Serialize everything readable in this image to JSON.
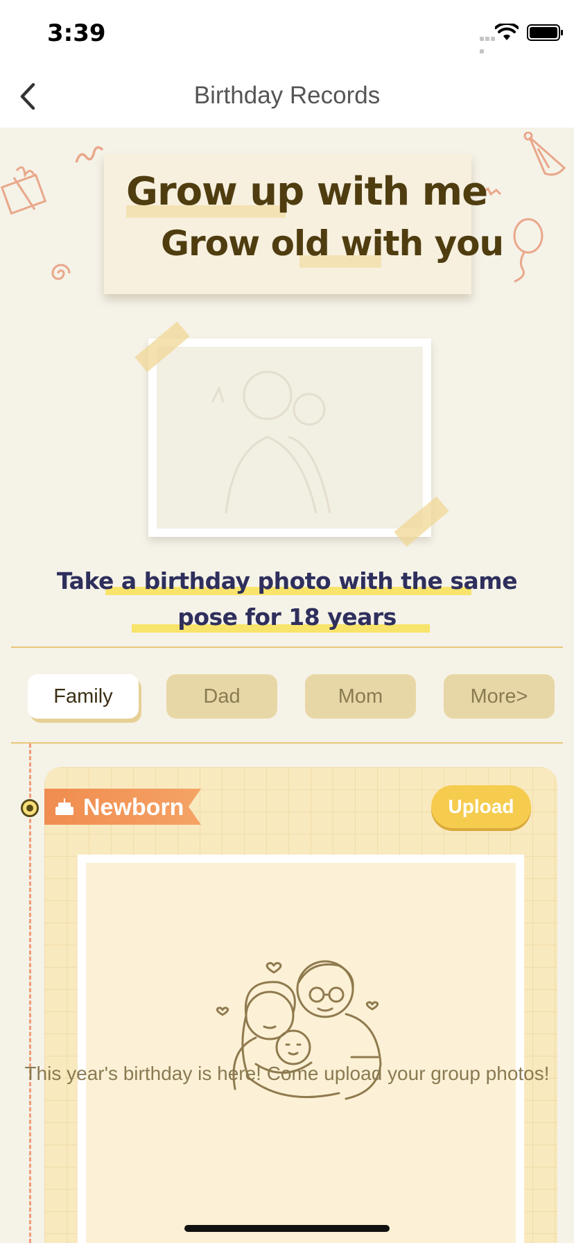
{
  "status_bar": {
    "time": "3:39"
  },
  "nav": {
    "title": "Birthday Records"
  },
  "banner": {
    "line1": "Grow up with me",
    "line2": "Grow old with you"
  },
  "slogan": {
    "line1": "Take a birthday photo with the same",
    "line2": "pose for 18 years"
  },
  "tabs": [
    {
      "label": "Family",
      "active": true
    },
    {
      "label": "Dad",
      "active": false
    },
    {
      "label": "Mom",
      "active": false
    },
    {
      "label": "More>",
      "active": false
    }
  ],
  "entry": {
    "stage": "Newborn",
    "upload_label": "Upload",
    "hint": "This year's birthday is here! Come upload your group photos!"
  },
  "colors": {
    "accent_orange": "#f08c4f",
    "upload_yellow": "#f6cc4f",
    "slogan_navy": "#2e2f5c",
    "banner_brown": "#4f3d10"
  }
}
